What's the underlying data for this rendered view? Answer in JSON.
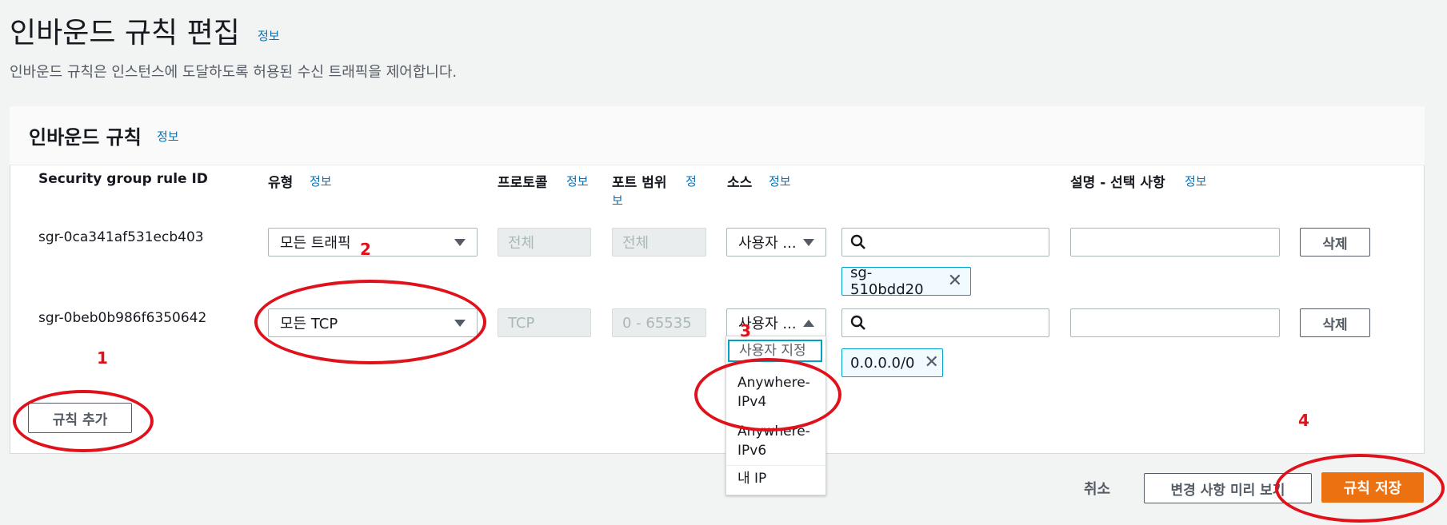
{
  "header": {
    "title": "인바운드 규칙 편집",
    "info": "정보",
    "description": "인바운드 규칙은 인스턴스에 도달하도록 허용된 수신 트래픽을 제어합니다."
  },
  "panel": {
    "title": "인바운드 규칙",
    "info": "정보"
  },
  "columns": {
    "rule_id": "Security group rule ID",
    "type": "유형",
    "protocol": "프로토콜",
    "port_range_line1": "포트 범위",
    "port_range_line2": "보",
    "port_info": "정",
    "source": "소스",
    "description": "설명 - 선택 사항",
    "info": "정보"
  },
  "rules": [
    {
      "id": "sgr-0ca341af531ecb403",
      "type": "모든 트래픽",
      "protocol": "전체",
      "port": "전체",
      "source": "사용자 ...",
      "token": "sg-510bdd20",
      "delete": "삭제"
    },
    {
      "id": "sgr-0beb0b986f6350642",
      "type": "모든 TCP",
      "protocol": "TCP",
      "port": "0 - 65535",
      "source": "사용자 ...",
      "token": "0.0.0.0/0",
      "delete": "삭제"
    }
  ],
  "dropdown": {
    "items": [
      "사용자 지정",
      "Anywhere-IPv4",
      "Anywhere-IPv6",
      "내 IP"
    ]
  },
  "buttons": {
    "add_rule": "규칙 추가",
    "cancel": "취소",
    "preview": "변경 사항 미리 보기",
    "save": "규칙 저장"
  },
  "annotations": [
    "1",
    "2",
    "3",
    "4"
  ],
  "colors": {
    "accent": "#ec7211",
    "link": "#0073bb",
    "annotation": "#e0111b",
    "token_border": "#00a1c9"
  }
}
